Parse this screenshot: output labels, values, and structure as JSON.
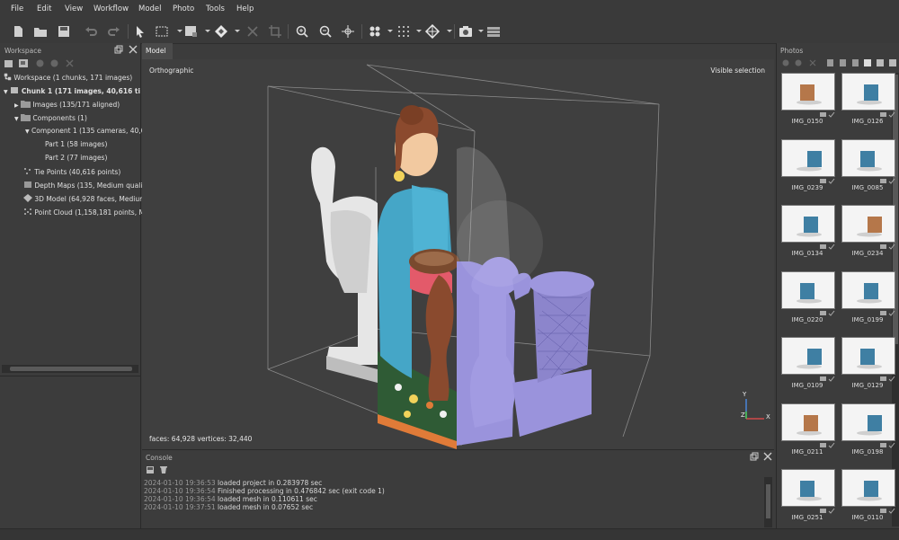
{
  "menu": [
    "File",
    "Edit",
    "View",
    "Workflow",
    "Model",
    "Photo",
    "Tools",
    "Help"
  ],
  "workspace": {
    "title": "Workspace",
    "items": [
      "Workspace (1 chunks, 171 images)",
      "Chunk 1 (171 images, 40,616 ti",
      "Images (135/171 aligned)",
      "Components (1)",
      "Component 1 (135 cameras, 40,6",
      "Part 1 (58 images)",
      "Part 2 (77 images)",
      "Tie Points (40,616 points)",
      "Depth Maps (135, Medium qualit",
      "3D Model (64,928 faces, Medium",
      "Point Cloud (1,158,181 points, M"
    ]
  },
  "model": {
    "tab": "Model",
    "projection": "Orthographic",
    "selection": "Visible selection",
    "stats": "faces: 64,928 vertices: 32,440",
    "axes": [
      "Y",
      "Z",
      "X"
    ]
  },
  "console": {
    "title": "Console",
    "lines": [
      {
        "ts": "2024-01-10 19:36:53",
        "msg": "loaded project in 0.283978 sec"
      },
      {
        "ts": "2024-01-10 19:36:54",
        "msg": "Finished processing in 0.476842 sec (exit code 1)"
      },
      {
        "ts": "2024-01-10 19:36:54",
        "msg": "loaded mesh in 0.110611 sec"
      },
      {
        "ts": "2024-01-10 19:37:51",
        "msg": "loaded mesh in 0.07652 sec"
      }
    ]
  },
  "photos": {
    "title": "Photos",
    "items": [
      "IMG_0150",
      "IMG_0126",
      "IMG_0239",
      "IMG_0085",
      "IMG_0134",
      "IMG_0234",
      "IMG_0220",
      "IMG_0199",
      "IMG_0109",
      "IMG_0129",
      "IMG_0211",
      "IMG_0198",
      "IMG_0251",
      "IMG_0110"
    ]
  },
  "colors": {
    "mesh": "#9a93dc",
    "dress": "#45a6c7",
    "accent": "#e07b38"
  }
}
